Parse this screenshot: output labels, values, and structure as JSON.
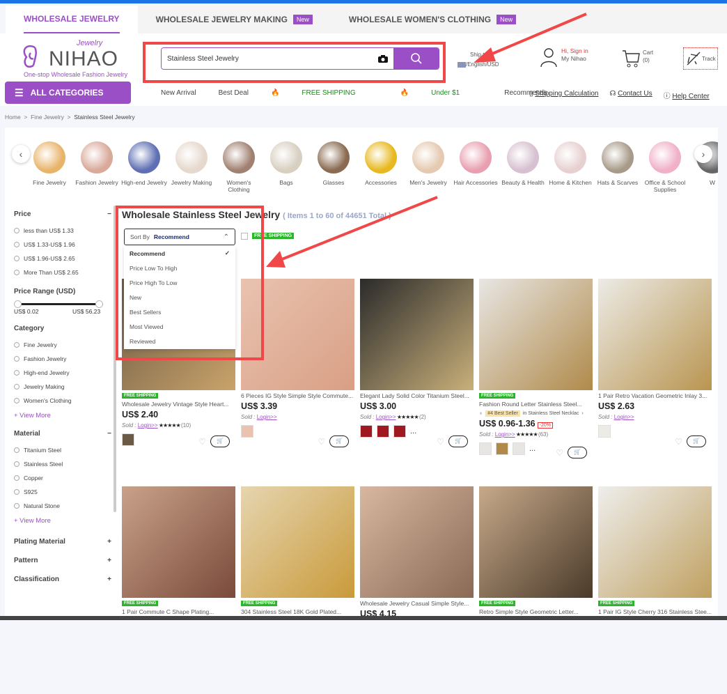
{
  "top_tabs": [
    {
      "label": "WHOLESALE JEWELRY",
      "badge": ""
    },
    {
      "label": "WHOLESALE JEWELRY MAKING",
      "badge": "New"
    },
    {
      "label": "WHOLESALE WOMEN'S CLOTHING",
      "badge": "New"
    }
  ],
  "logo": {
    "script": "Jewelry",
    "name": "NIHAO",
    "tagline": "One-stop Wholesale Fashion Jewelry"
  },
  "search": {
    "value": "Stainless Steel Jewelry"
  },
  "ship": {
    "label": "Ship to:",
    "value": "/English/USD"
  },
  "account": {
    "line1": "Hi, Sign in",
    "line2": "My Nihao"
  },
  "cart": {
    "label": "Cart",
    "count": "(0)"
  },
  "track": {
    "label": "Track"
  },
  "all_categories": "ALL CATEGORIES",
  "nav": [
    "New Arrival",
    "Best Deal",
    "FREE SHIPPING",
    "Under $1",
    "Recommends"
  ],
  "links": [
    "Shipping Calculation",
    "Contact Us",
    "Help Center"
  ],
  "breadcrumb": [
    "Home",
    "Fine Jewelry",
    "Stainless Steel Jewelry"
  ],
  "categories": [
    "Fine Jewelry",
    "Fashion Jewelry",
    "High-end Jewelry",
    "Jewelry Making",
    "Women's Clothing",
    "Bags",
    "Glasses",
    "Accessories",
    "Men's Jewelry",
    "Hair Accessories",
    "Beauty & Health",
    "Home & Kitchen",
    "Hats & Scarves",
    "Office & School Supplies",
    "W"
  ],
  "filters": {
    "price": {
      "title": "Price",
      "options": [
        "less than US$ 1.33",
        "US$ 1.33-US$ 1.96",
        "US$ 1.96-US$ 2.65",
        "More Than US$ 2.65"
      ]
    },
    "price_range": {
      "title": "Price Range (USD)",
      "min": "US$ 0.02",
      "max": "US$ 56.23"
    },
    "category": {
      "title": "Category",
      "options": [
        "Fine Jewelry",
        "Fashion Jewelry",
        "High-end Jewelry",
        "Jewelry Making",
        "Women's Clothing"
      ],
      "more": "+ View More"
    },
    "material": {
      "title": "Material",
      "options": [
        "Titanium Steel",
        "Stainless Steel",
        "Copper",
        "S925",
        "Natural Stone"
      ],
      "more": "+ View More"
    },
    "collapsed": [
      "Plating Material",
      "Pattern",
      "Classification"
    ]
  },
  "listing": {
    "title": "Wholesale Stainless Steel Jewelry",
    "count": "( Items 1 to 60 of 44651 Total )",
    "sort_label": "Sort By",
    "sort_value": "Recommend",
    "sort_options": [
      "Recommend",
      "Price Low To High",
      "Price High To Low",
      "New",
      "Best Sellers",
      "Most Viewed",
      "Reviewed"
    ],
    "free_shipping": "FREE SHIPPING"
  },
  "products": [
    {
      "name": "Wholesale Jewelry Vintage Style Heart...",
      "price": "US$ 2.40",
      "free_shipping": "FREE SHIPPING",
      "sold": "Sold :",
      "login": "Login>>",
      "reviews": "(10)",
      "colors": [
        "#6b5a45",
        "#c9a36a"
      ]
    },
    {
      "name": "6 Pieces IG Style Simple Style Commute...",
      "price": "US$ 3.39",
      "free_shipping": "",
      "sold": "Sold :",
      "login": "Login>>",
      "reviews": "",
      "colors": [
        "#e9c3b0",
        "#d99f85"
      ]
    },
    {
      "name": "Elegant Lady Solid Color Titanium Steel...",
      "price": "US$ 3.00",
      "free_shipping": "",
      "sold": "Sold :",
      "login": "Login>>",
      "reviews": "(2)",
      "colors": [
        "#2b2b2b",
        "#c9b07a"
      ]
    },
    {
      "name": "Fashion Round Letter Stainless Steel...",
      "price": "US$ 0.96-1.36",
      "discount": "-20%",
      "best_seller": "#4 Best Seller",
      "best_in": "in Stainless Steel Necklac",
      "free_shipping": "FREE SHIPPING",
      "sold": "Sold :",
      "login": "Login>>",
      "reviews": "(63)",
      "colors": [
        "#e8e6e3",
        "#b08a4a"
      ]
    },
    {
      "name": "1 Pair Retro Vacation Geometric Inlay 3...",
      "price": "US$ 2.63",
      "free_shipping": "",
      "sold": "Sold :",
      "login": "Login>>",
      "reviews": "",
      "colors": [
        "#ecebe6",
        "#b99550"
      ]
    },
    {
      "name": "1 Pair Commute C Shape Plating...",
      "price": "",
      "free_shipping": "FREE SHIPPING",
      "colors": [
        "#c9a28a",
        "#7a4a3a"
      ]
    },
    {
      "name": "304 Stainless Steel 18K Gold Plated...",
      "price": "",
      "free_shipping": "FREE SHIPPING",
      "colors": [
        "#e6d5b0",
        "#c99a3a"
      ]
    },
    {
      "name": "Wholesale Jewelry Casual Simple Style...",
      "price": "US$ 4.15",
      "free_shipping": "",
      "colors": [
        "#d8b7a0",
        "#8a6a55"
      ]
    },
    {
      "name": "Retro Simple Style Geometric Letter...",
      "price": "",
      "free_shipping": "FREE SHIPPING",
      "colors": [
        "#c7a98a",
        "#4a3a2a"
      ]
    },
    {
      "name": "1 Pair IG Style Cherry 316 Stainless Stee...",
      "price": "",
      "free_shipping": "FREE SHIPPING",
      "colors": [
        "#eeeeec",
        "#c0a060"
      ]
    }
  ],
  "annotation_color": "#f04848",
  "accent": "#9b4fc6"
}
